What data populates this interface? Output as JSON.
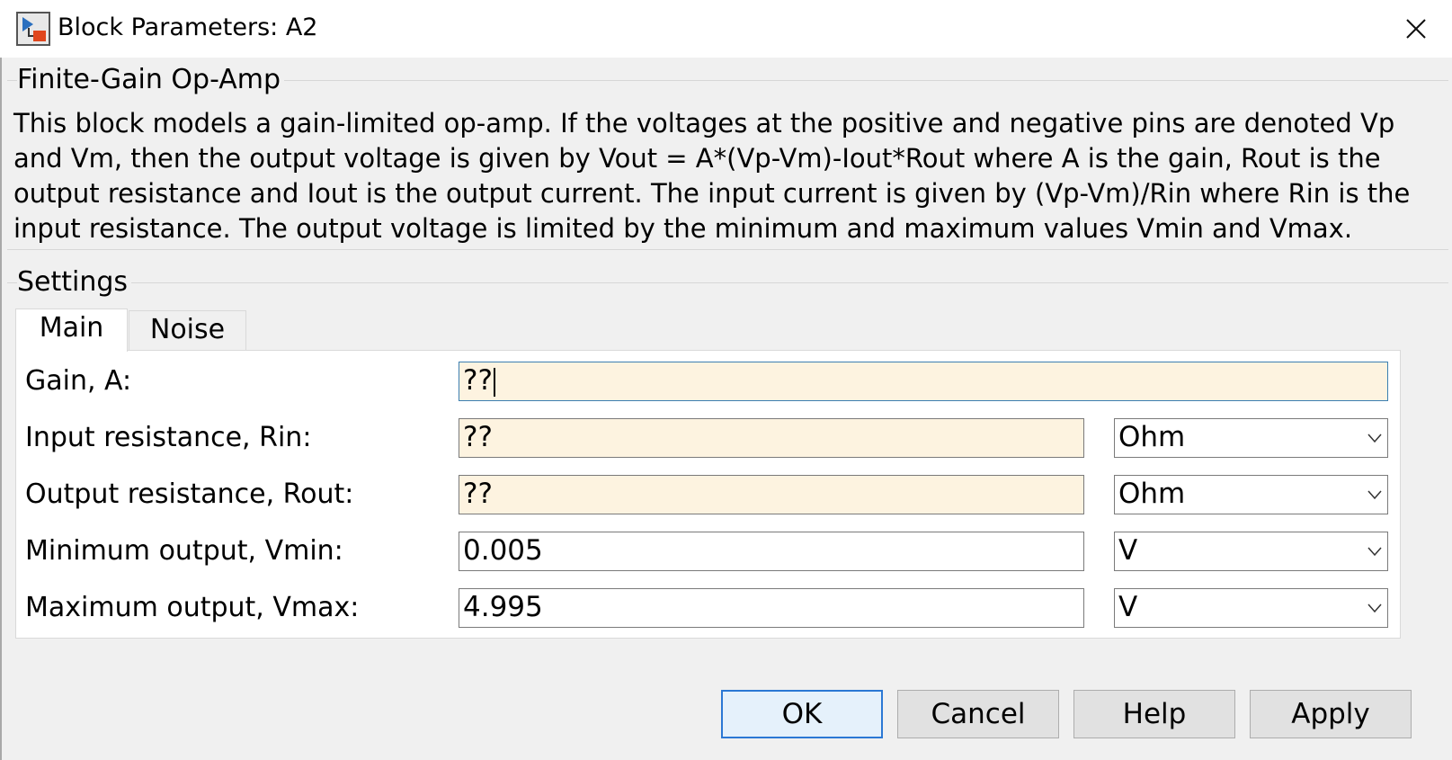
{
  "window": {
    "title": "Block Parameters: A2"
  },
  "block": {
    "name": "Finite-Gain Op-Amp",
    "description": "This block models a gain-limited op-amp. If the voltages at the positive and negative pins are denoted Vp and Vm, then the output voltage is given by Vout = A*(Vp-Vm)-Iout*Rout where A is the gain, Rout is the output resistance and Iout is the output current. The input current is given by (Vp-Vm)/Rin where Rin is the input resistance. The output voltage is limited by the minimum and maximum values Vmin and Vmax."
  },
  "settings": {
    "label": "Settings",
    "tabs": [
      {
        "label": "Main",
        "selected": true
      },
      {
        "label": "Noise",
        "selected": false
      }
    ],
    "params": [
      {
        "label": "Gain, A:",
        "value": "??"
      },
      {
        "label": "Input resistance, Rin:",
        "value": "??",
        "unit": "Ohm"
      },
      {
        "label": "Output resistance, Rout:",
        "value": "??",
        "unit": "Ohm"
      },
      {
        "label": "Minimum output, Vmin:",
        "value": "0.005",
        "unit": "V"
      },
      {
        "label": "Maximum output, Vmax:",
        "value": "4.995",
        "unit": "V"
      }
    ]
  },
  "buttons": {
    "ok": "OK",
    "cancel": "Cancel",
    "help": "Help",
    "apply": "Apply"
  },
  "icons": {
    "app": "simulink-block-icon",
    "close": "close-icon",
    "dropdown": "chevron-down-icon"
  },
  "colors": {
    "invalid_field_bg": "#fdf3e0",
    "focus_border": "#3c7fb1",
    "default_button_border": "#2b78d4"
  }
}
